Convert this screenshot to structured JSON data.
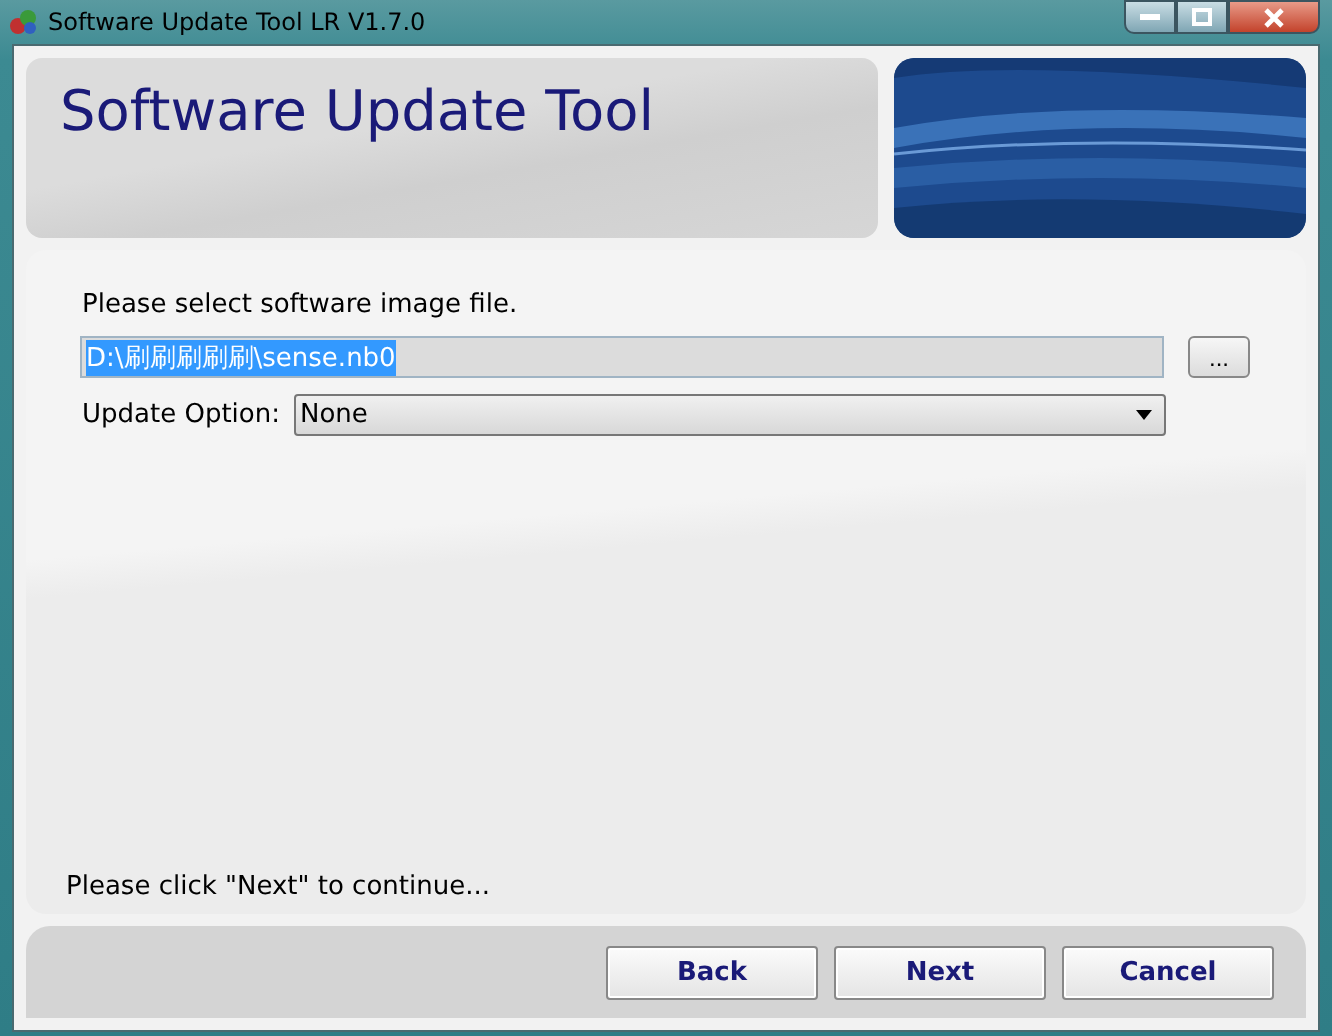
{
  "window": {
    "title": "Software Update Tool LR V1.7.0"
  },
  "header": {
    "title": "Software Update Tool",
    "kind": "picture"
  },
  "file_prompt": "Please select software image file.",
  "file_field": {
    "value": "D:\\刷刷刷刷刷\\sense.nb0",
    "selected": true
  },
  "browse_button": "...",
  "update_option": {
    "label": "Update Option:",
    "value": "None"
  },
  "status": "Please click \"Next\" to continue...",
  "buttons": [
    "Back",
    "Next",
    "Cancel"
  ]
}
